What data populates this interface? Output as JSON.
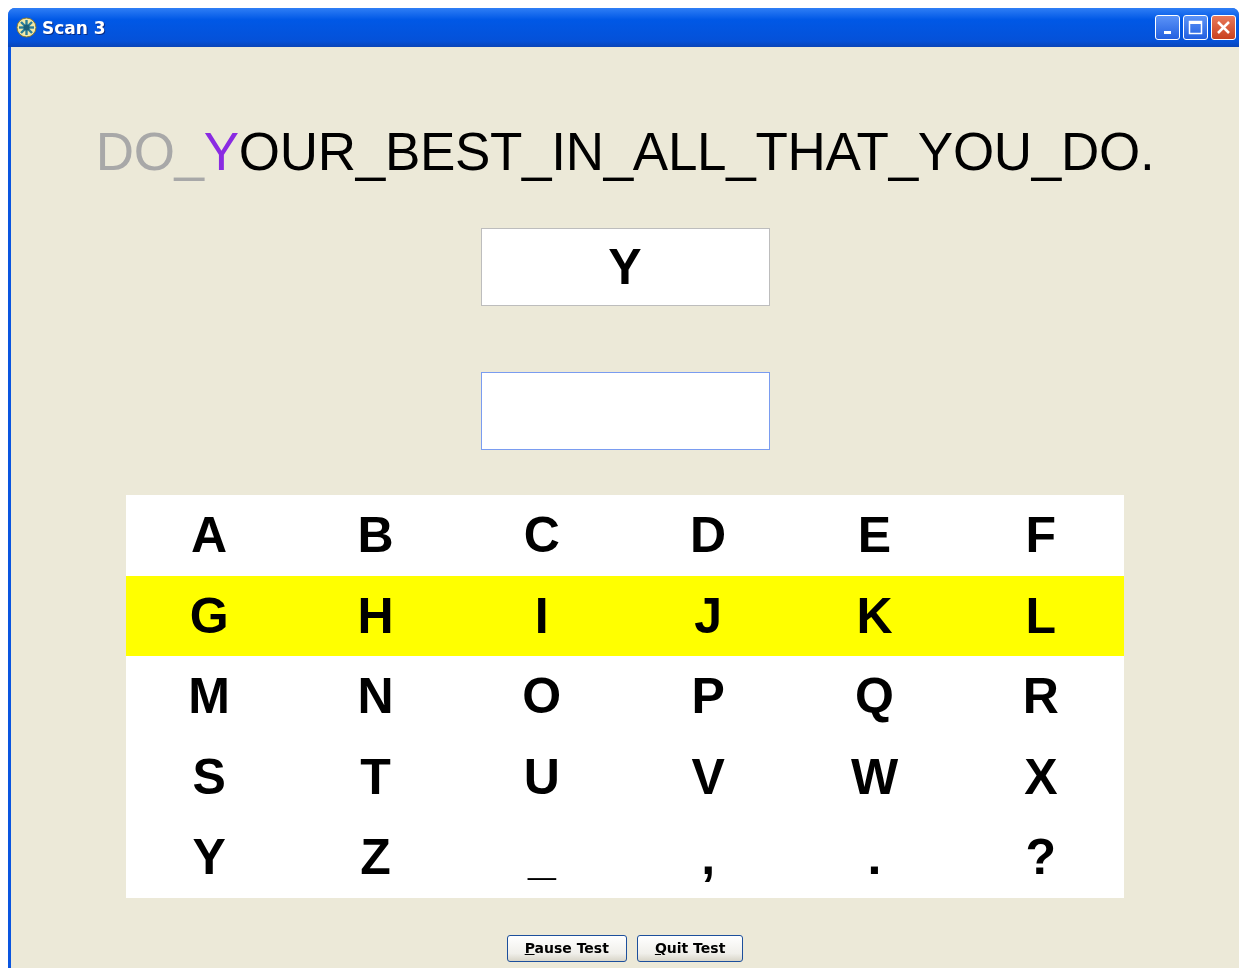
{
  "window": {
    "title": "Scan 3"
  },
  "sentence": {
    "done": "DO_",
    "current": "Y",
    "remaining": "OUR_BEST_IN_ALL_THAT_YOU_DO."
  },
  "target_letter": "Y",
  "keyboard": {
    "rows": [
      {
        "selected": false,
        "keys": [
          "A",
          "B",
          "C",
          "D",
          "E",
          "F"
        ]
      },
      {
        "selected": true,
        "keys": [
          "G",
          "H",
          "I",
          "J",
          "K",
          "L"
        ]
      },
      {
        "selected": false,
        "keys": [
          "M",
          "N",
          "O",
          "P",
          "Q",
          "R"
        ]
      },
      {
        "selected": false,
        "keys": [
          "S",
          "T",
          "U",
          "V",
          "W",
          "X"
        ]
      },
      {
        "selected": false,
        "keys": [
          "Y",
          "Z",
          "_",
          ",",
          ".",
          "?"
        ]
      }
    ]
  },
  "buttons": [
    {
      "label": "Pause Test"
    },
    {
      "label": "Quit Test"
    }
  ]
}
